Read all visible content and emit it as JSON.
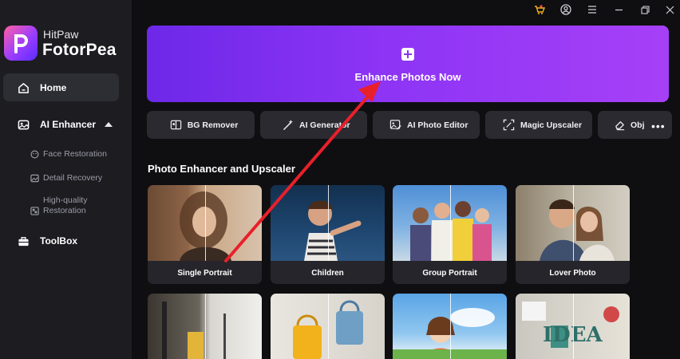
{
  "brand": {
    "top": "HitPaw",
    "main": "FotorPea"
  },
  "sidebar": {
    "home": "Home",
    "ai_enhancer": "AI Enhancer",
    "sub_items": [
      "Face Restoration",
      "Detail Recovery",
      "High-quality",
      "Restoration"
    ],
    "toolbox": "ToolBox"
  },
  "titlebar": {
    "icons": [
      "gift-icon",
      "account-icon",
      "menu-icon",
      "minimize-icon",
      "restore-icon",
      "close-icon"
    ]
  },
  "hero": {
    "label": "Enhance Photos Now"
  },
  "tools": [
    {
      "label": "BG Remover",
      "icon": "bg-remover-icon"
    },
    {
      "label": "AI Generator",
      "icon": "magic-wand-icon"
    },
    {
      "label": "AI Photo Editor",
      "icon": "photo-editor-icon"
    },
    {
      "label": "Magic Upscaler",
      "icon": "upscale-icon"
    },
    {
      "label": "Obj",
      "icon": "eraser-icon"
    }
  ],
  "section": {
    "title": "Photo Enhancer and Upscaler"
  },
  "cards": [
    {
      "label": "Single Portrait"
    },
    {
      "label": "Children"
    },
    {
      "label": "Group Portrait"
    },
    {
      "label": "Lover Photo"
    }
  ],
  "colors": {
    "accent": "#8d34f5",
    "annotation_arrow": "#e8202a",
    "sidebar_bg": "#1c1c21",
    "app_bg": "#0f0f12"
  }
}
